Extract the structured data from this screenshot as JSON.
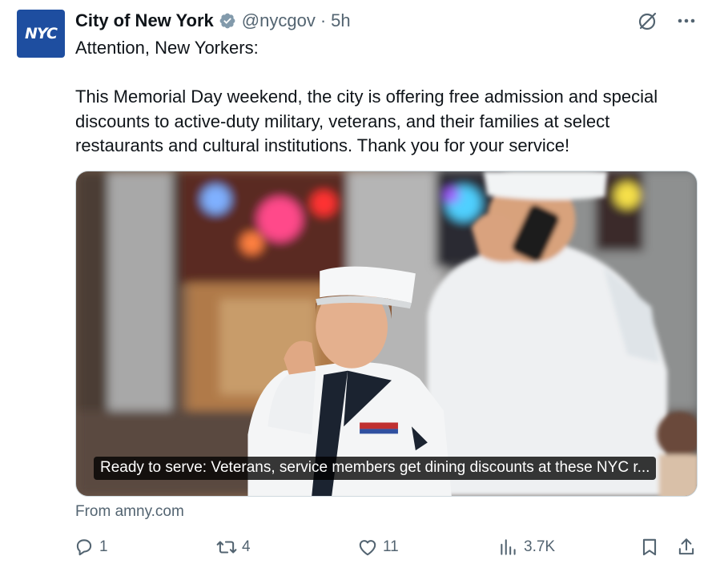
{
  "author": {
    "avatar_text": "NYC",
    "display_name": "City of New York",
    "handle": "@nycgov",
    "separator": "·",
    "time": "5h",
    "verified_badge_color": "#829aab",
    "avatar_color": "#1e4ea0"
  },
  "top_actions": {
    "grok_icon": "grok-icon",
    "more_icon": "more-icon"
  },
  "tweet": {
    "line1": "Attention, New Yorkers:",
    "line2": "This Memorial Day weekend, the city is offering free admission and special discounts to active-duty military, veterans, and their families at select restaurants and cultural institutions. Thank you for your service!"
  },
  "card": {
    "caption": "Ready to serve: Veterans, service members get dining discounts at these NYC r...",
    "source": "From amny.com"
  },
  "actions": {
    "reply_count": "1",
    "retweet_count": "4",
    "like_count": "11",
    "views_count": "3.7K"
  },
  "colors": {
    "text_primary": "#0f1419",
    "text_secondary": "#536471"
  }
}
